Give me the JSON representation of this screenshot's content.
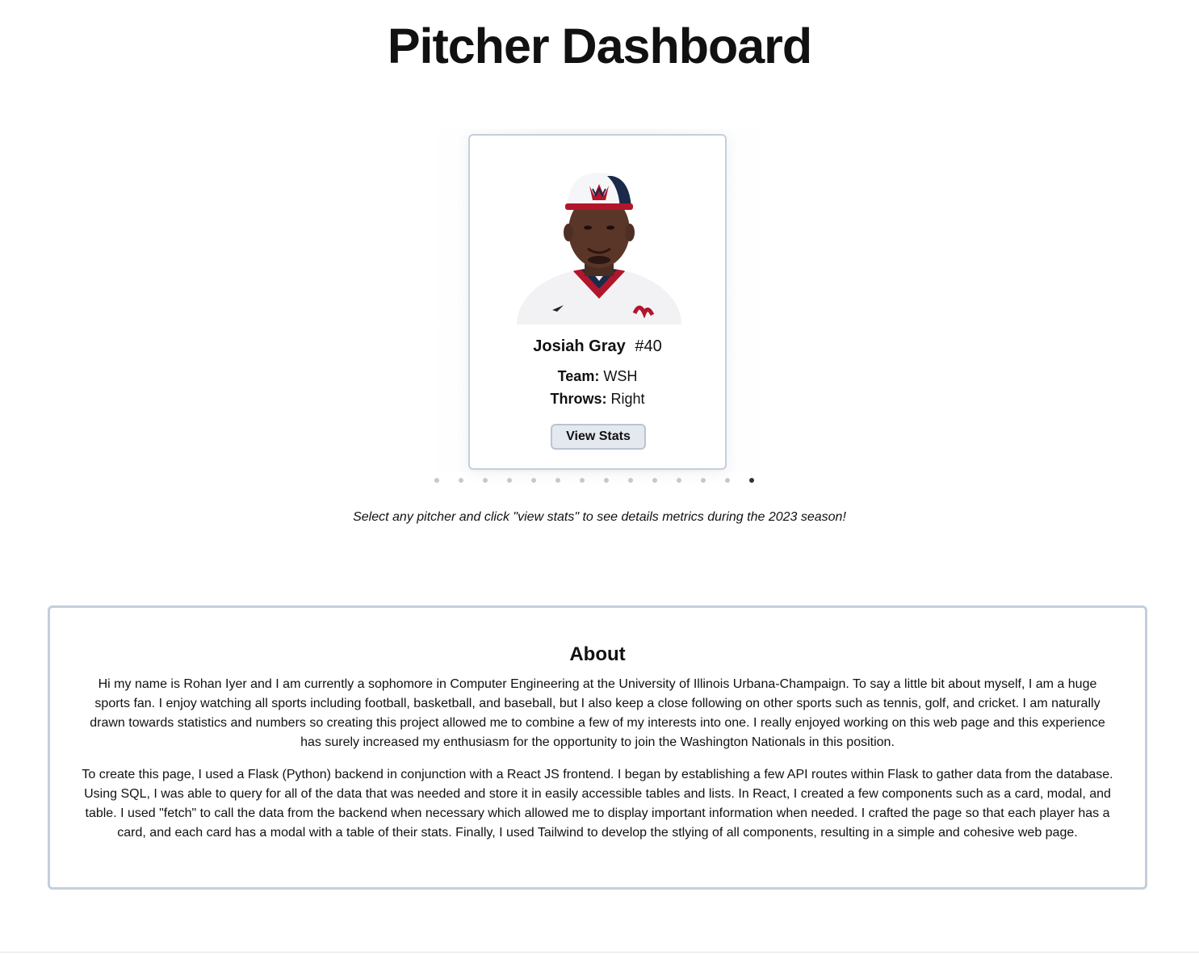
{
  "page": {
    "title": "Pitcher Dashboard"
  },
  "carousel": {
    "card": {
      "name": "Josiah Gray",
      "number": "#40",
      "team_label": "Team:",
      "team_value": "WSH",
      "throws_label": "Throws:",
      "throws_value": "Right",
      "button_label": "View Stats",
      "photo": "player-headshot"
    },
    "dot_count": 14,
    "active_dot": 14
  },
  "instructions": "Select any pitcher and click \"view stats\" to see details metrics during the 2023 season!",
  "about": {
    "title": "About",
    "paragraphs": [
      "Hi my name is Rohan Iyer and I am currently a sophomore in Computer Engineering at the University of Illinois Urbana-Champaign. To say a little bit about myself, I am a huge sports fan. I enjoy watching all sports including football, basketball, and baseball, but I also keep a close following on other sports such as tennis, golf, and cricket. I am naturally drawn towards statistics and numbers so creating this project allowed me to combine a few of my interests into one. I really enjoyed working on this web page and this experience has surely increased my enthusiasm for the opportunity to join the Washington Nationals in this position.",
      "To create this page, I used a Flask (Python) backend in conjunction with a React JS frontend. I began by establishing a few API routes within Flask to gather data from the database. Using SQL, I was able to query for all of the data that was needed and store it in easily accessible tables and lists. In React, I created a few components such as a card, modal, and table. I used \"fetch\" to call the data from the backend when necessary which allowed me to display important information when needed. I crafted the page so that each player has a card, and each card has a modal with a table of their stats. Finally, I used Tailwind to develop the stlying of all components, resulting in a simple and cohesive web page."
    ]
  },
  "colors": {
    "card_border": "#c3cfdc",
    "button_bg": "#e4e9f0",
    "dot_inactive": "#c8c8c8",
    "dot_active": "#333333"
  }
}
